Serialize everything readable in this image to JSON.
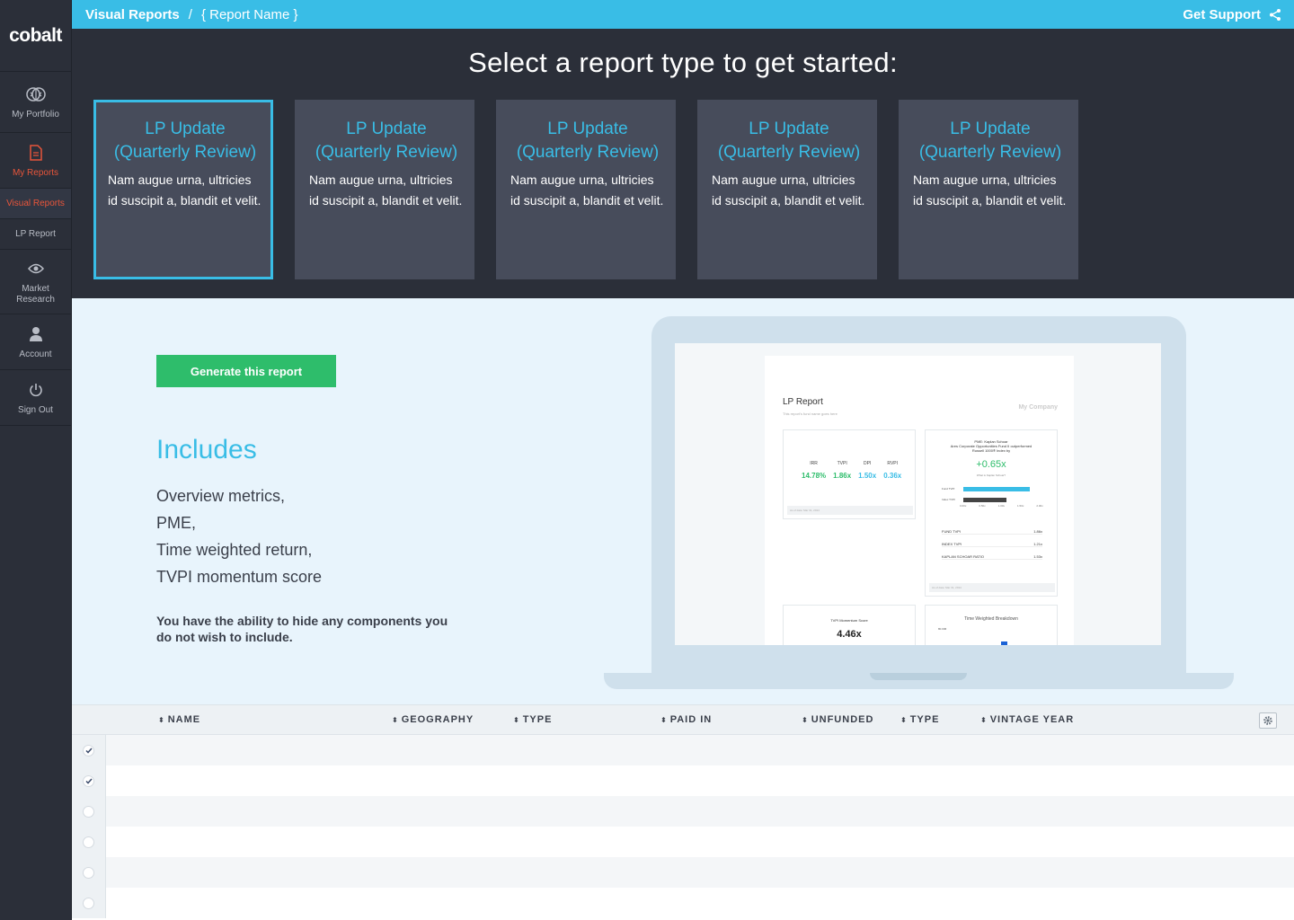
{
  "app": {
    "logo": "cobalt"
  },
  "sidebar": {
    "items": [
      {
        "label": "My Portfolio"
      },
      {
        "label": "My Reports"
      },
      {
        "label": "Visual Reports"
      },
      {
        "label": "LP Report"
      },
      {
        "label": "Market Research"
      },
      {
        "label": "Account"
      },
      {
        "label": "Sign Out"
      }
    ]
  },
  "topbar": {
    "crumb1": "Visual Reports",
    "separator": "/",
    "crumb2": "{ Report Name }",
    "support": "Get Support"
  },
  "report_types": {
    "heading": "Select a report type to get started:",
    "cards": [
      {
        "title": "LP Update (Quarterly Review)",
        "desc": "Nam augue urna, ultricies id suscipit a, blandit et velit."
      },
      {
        "title": "LP Update (Quarterly Review)",
        "desc": "Nam augue urna, ultricies id suscipit a, blandit et velit."
      },
      {
        "title": "LP Update (Quarterly Review)",
        "desc": "Nam augue urna, ultricies id suscipit a, blandit et velit."
      },
      {
        "title": "LP Update (Quarterly Review)",
        "desc": "Nam augue urna, ultricies id suscipit a, blandit et velit."
      },
      {
        "title": "LP Update (Quarterly Review)",
        "desc": "Nam augue urna, ultricies id suscipit a, blandit et velit."
      }
    ]
  },
  "info": {
    "generate_label": "Generate this report",
    "includes_heading": "Includes",
    "includes_items": [
      "Overview metrics,",
      "PME,",
      "Time weighted return,",
      "TVPI momentum score"
    ],
    "note": "You have the ability to hide any components you do not wish to include."
  },
  "preview": {
    "title": "LP Report",
    "subtitle": "This report's fund name goes here",
    "company": "My Company",
    "metrics": [
      {
        "label": "IRR",
        "value": "14.78%",
        "color": "#2ebd6b"
      },
      {
        "label": "TVPI",
        "value": "1.86x",
        "color": "#2ebd6b"
      },
      {
        "label": "DPI",
        "value": "1.50x",
        "color": "#39bde6"
      },
      {
        "label": "RVPI",
        "value": "0.36x",
        "color": "#39bde6"
      }
    ],
    "metrics_foot": "As of date: Mar 31, 2014",
    "pme_heading_1": "PME: Kaplan Schoar",
    "pme_heading_2": "Ares Corporate Opportunities Fund II outperformed",
    "pme_heading_3": "Russell 1000® Index by",
    "pme_value": "+0.65x",
    "pme_question": "What is Kaplan Schoar?",
    "pme_bars": [
      {
        "label": "Fund TVPI",
        "value": 1.86,
        "color": "#39bde6"
      },
      {
        "label": "Index TVPI",
        "value": 1.21,
        "color": "#444444"
      }
    ],
    "pme_axis": [
      "0.00x",
      "0.50x",
      "1.00x",
      "1.50x",
      "2.00x"
    ],
    "pme_rows": [
      {
        "label": "FUND TVPI",
        "value": "1.86x"
      },
      {
        "label": "INDEX TVPI",
        "value": "1.21x"
      },
      {
        "label": "KAPLAN SCHOAR RATIO",
        "value": "1.53x"
      }
    ],
    "pme_foot": "As of date: Mar 31, 2014",
    "momentum_label": "TVPI Momentum Score",
    "momentum_value": "4.46x",
    "twr_label": "Time Weighted Breakdown",
    "twr_y": "80.00€"
  },
  "table": {
    "columns": [
      "NAME",
      "GEOGRAPHY",
      "TYPE",
      "PAID IN",
      "UNFUNDED",
      "TYPE",
      "VINTAGE YEAR"
    ],
    "rows": [
      {
        "checked": true
      },
      {
        "checked": true
      },
      {
        "checked": false
      },
      {
        "checked": false
      },
      {
        "checked": false
      },
      {
        "checked": false
      }
    ]
  },
  "colors": {
    "accent": "#39bde6",
    "active": "#e8553a",
    "success": "#2ebd6b",
    "dark": "#2b2f39"
  }
}
